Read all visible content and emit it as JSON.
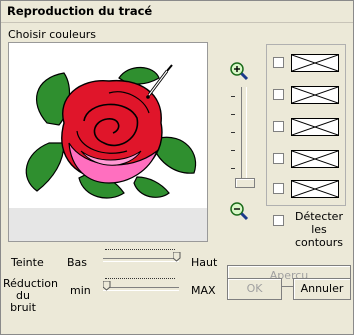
{
  "window": {
    "title": "Reproduction du tracé"
  },
  "colors_group": {
    "label": "Choisir couleurs"
  },
  "detect": {
    "label": "Détecter les contours",
    "checked": false
  },
  "colors": [
    {
      "checked": false
    },
    {
      "checked": false
    },
    {
      "checked": false
    },
    {
      "checked": false
    },
    {
      "checked": false
    }
  ],
  "tint": {
    "label": "Teinte",
    "min_label": "Bas",
    "max_label": "Haut",
    "level": 1.0
  },
  "noise": {
    "label_line1": "Réduction",
    "label_line2": "du bruit",
    "min_label": "min",
    "max_label": "MAX",
    "level": 0.0
  },
  "buttons": {
    "preview": "Aperçu",
    "ok": "OK",
    "cancel": "Annuler"
  },
  "icons": {
    "zoom_in": "zoom-in-icon",
    "zoom_out": "zoom-out-icon",
    "image": "rose-image"
  }
}
